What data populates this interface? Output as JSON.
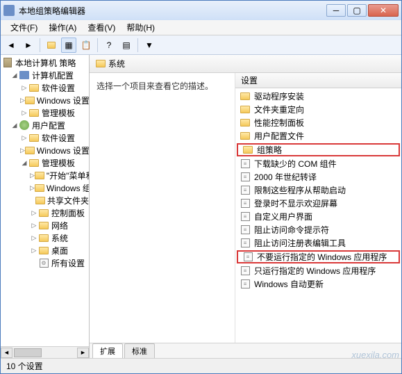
{
  "window": {
    "title": "本地组策略编辑器"
  },
  "menu": {
    "file": "文件(F)",
    "action": "操作(A)",
    "view": "查看(V)",
    "help": "帮助(H)"
  },
  "tree": {
    "root": "本地计算机 策略",
    "computer": "计算机配置",
    "comp_soft": "软件设置",
    "comp_win": "Windows 设置",
    "comp_admin": "管理模板",
    "user": "用户配置",
    "user_soft": "软件设置",
    "user_win": "Windows 设置",
    "user_admin": "管理模板",
    "start": "\"开始\"菜单和任务栏",
    "wind": "Windows 组件",
    "share": "共享文件夹",
    "control": "控制面板",
    "network": "网络",
    "system": "系统",
    "desktop": "桌面",
    "all": "所有设置"
  },
  "header": {
    "icon_label": "系统"
  },
  "desc": {
    "text": "选择一个项目来查看它的描述。"
  },
  "list_header": "设置",
  "items": [
    {
      "type": "folder",
      "label": "驱动程序安装"
    },
    {
      "type": "folder",
      "label": "文件夹重定向"
    },
    {
      "type": "folder",
      "label": "性能控制面板"
    },
    {
      "type": "folder",
      "label": "用户配置文件"
    },
    {
      "type": "folder",
      "label": "组策略",
      "hl": true
    },
    {
      "type": "setting",
      "label": "下载缺少的 COM 组件"
    },
    {
      "type": "setting",
      "label": "2000 年世纪转译"
    },
    {
      "type": "setting",
      "label": "限制这些程序从帮助启动"
    },
    {
      "type": "setting",
      "label": "登录时不显示欢迎屏幕"
    },
    {
      "type": "setting",
      "label": "自定义用户界面"
    },
    {
      "type": "setting",
      "label": "阻止访问命令提示符"
    },
    {
      "type": "setting",
      "label": "阻止访问注册表编辑工具"
    },
    {
      "type": "setting",
      "label": "不要运行指定的 Windows 应用程序",
      "hl": true
    },
    {
      "type": "setting",
      "label": "只运行指定的 Windows 应用程序"
    },
    {
      "type": "setting",
      "label": "Windows 自动更新"
    }
  ],
  "tabs": {
    "extended": "扩展",
    "standard": "标准"
  },
  "status": {
    "text": "10 个设置"
  },
  "watermark": "xuexila.com"
}
